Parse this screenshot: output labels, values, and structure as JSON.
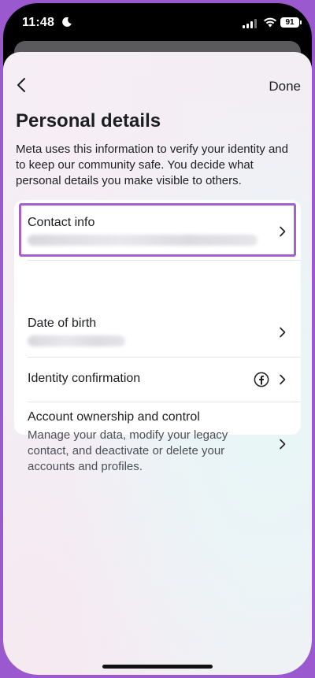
{
  "status_bar": {
    "time": "11:48",
    "battery": "91"
  },
  "nav": {
    "done_label": "Done"
  },
  "page": {
    "title": "Personal details",
    "description": "Meta uses this information to verify your identity and to keep our community safe. You decide what personal details you make visible to others."
  },
  "rows": [
    {
      "title": "Contact info"
    },
    {
      "title": "Date of birth"
    },
    {
      "title": "Identity confirmation"
    },
    {
      "title": "Account ownership and control",
      "subtitle": "Manage your data, modify your legacy contact, and deactivate or delete your accounts and profiles."
    }
  ],
  "colors": {
    "highlight": "#a660c9",
    "frame": "#9b59d0"
  }
}
